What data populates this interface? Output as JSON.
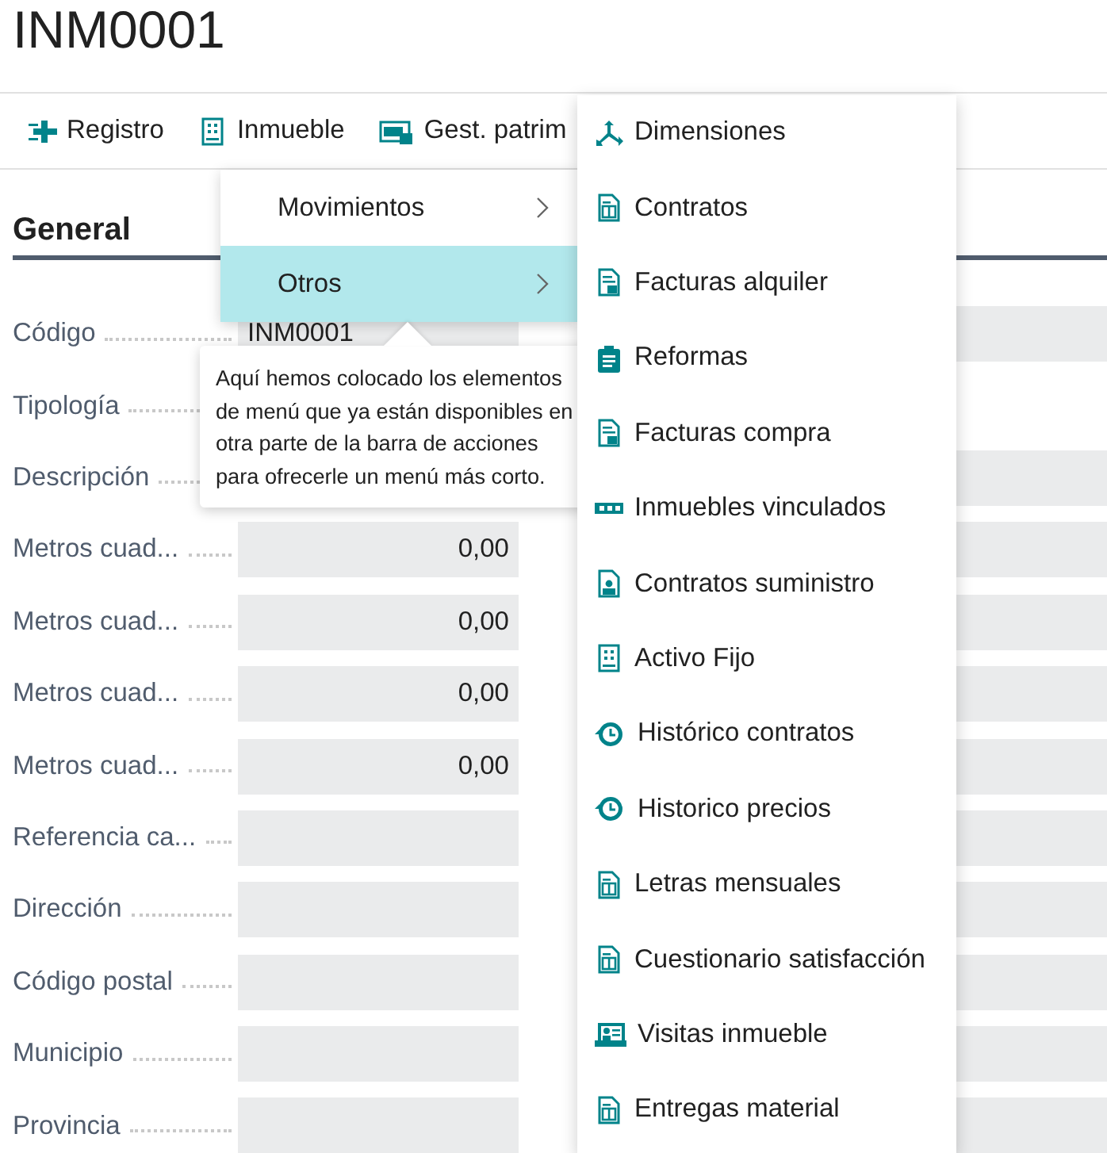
{
  "page_title": "INM0001",
  "actions": [
    {
      "label": "Registro"
    },
    {
      "label": "Inmueble"
    },
    {
      "label": "Gest. patrim"
    }
  ],
  "section_title": "General",
  "fields": [
    {
      "label": "Código",
      "kind": "text",
      "value": "INM0001"
    },
    {
      "label": "Tipología",
      "kind": "text"
    },
    {
      "label": "Descripción",
      "kind": "text"
    },
    {
      "label": "Metros cuad...",
      "kind": "decimal",
      "value": "0,00"
    },
    {
      "label": "Metros cuad...",
      "kind": "decimal",
      "value": "0,00"
    },
    {
      "label": "Metros cuad...",
      "kind": "decimal",
      "value": "0,00"
    },
    {
      "label": "Metros cuad...",
      "kind": "decimal",
      "value": "0,00"
    },
    {
      "label": "Referencia ca...",
      "kind": "text"
    },
    {
      "label": "Dirección",
      "kind": "text"
    },
    {
      "label": "Código postal",
      "kind": "text"
    },
    {
      "label": "Municipio",
      "kind": "text"
    },
    {
      "label": "Provincia",
      "kind": "text"
    }
  ],
  "menu": {
    "items": [
      {
        "label": "Movimientos",
        "selected": false
      },
      {
        "label": "Otros",
        "selected": true
      }
    ]
  },
  "tooltip": "Aquí hemos colocado los elementos de menú que ya están disponibles en otra parte de la barra de acciones para ofrecerle un menú más corto.",
  "submenu": {
    "items": [
      {
        "label": "Dimensiones"
      },
      {
        "label": "Contratos"
      },
      {
        "label": "Facturas alquiler"
      },
      {
        "label": "Reformas"
      },
      {
        "label": "Facturas compra"
      },
      {
        "label": "Inmuebles vinculados"
      },
      {
        "label": "Contratos suministro"
      },
      {
        "label": "Activo Fijo"
      },
      {
        "label": "Histórico contratos"
      },
      {
        "label": "Historico precios"
      },
      {
        "label": "Letras mensuales"
      },
      {
        "label": "Cuestionario satisfacción"
      },
      {
        "label": "Visitas inmueble"
      },
      {
        "label": "Entregas material"
      }
    ]
  }
}
